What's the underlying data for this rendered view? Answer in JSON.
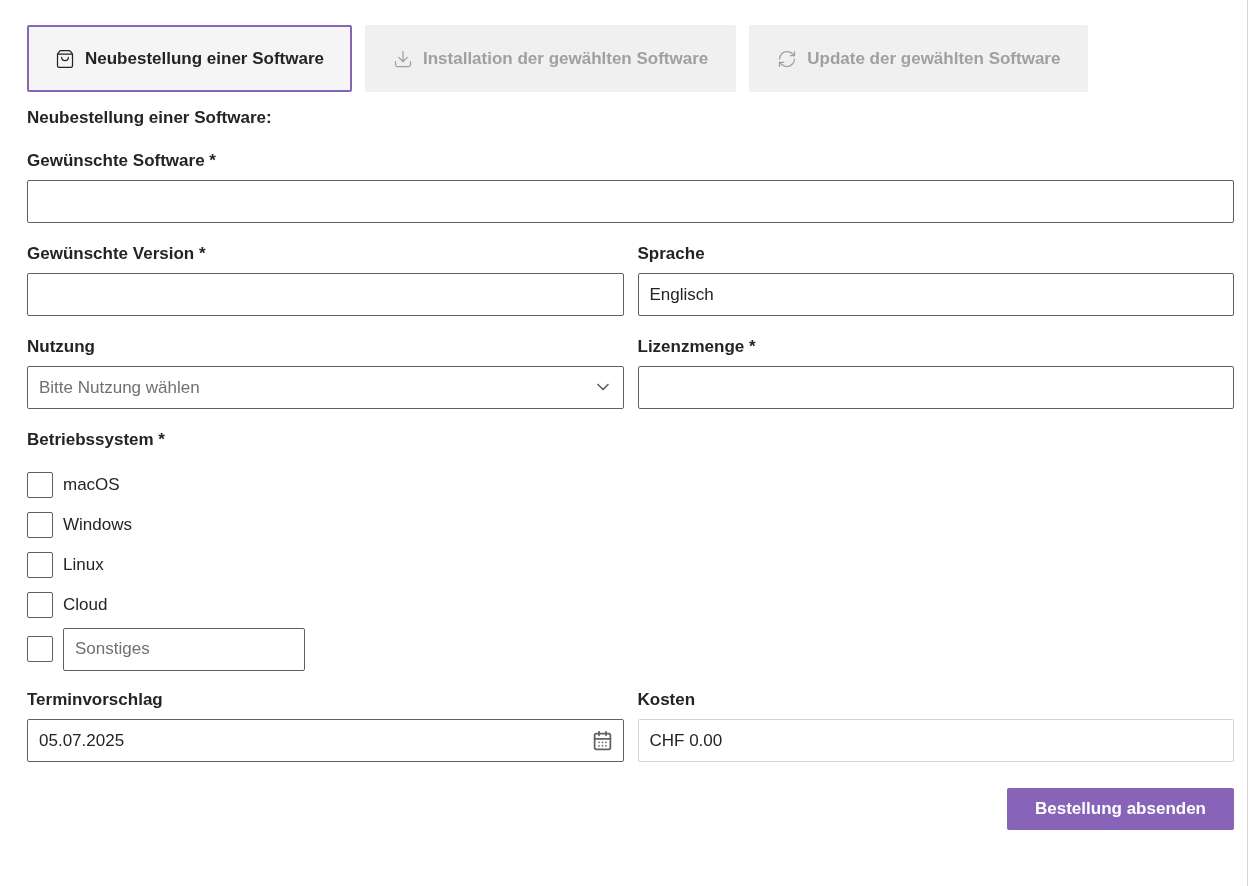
{
  "tabs": [
    {
      "label": "Neubestellung einer Software",
      "kind": "order",
      "selected": true
    },
    {
      "label": "Installation der gewählten Software",
      "kind": "install",
      "selected": false
    },
    {
      "label": "Update der gewählten Software",
      "kind": "update",
      "selected": false
    }
  ],
  "form": {
    "heading": "Neubestellung einer Software:",
    "rows": [
      {
        "fields": [
          {
            "label": "Gewünschte Software *",
            "kind": "text"
          }
        ]
      },
      {
        "fields": [
          {
            "label": "Gewünschte Version *",
            "kind": "text"
          },
          {
            "label": "Sprache",
            "kind": "text",
            "value": "Englisch"
          }
        ]
      },
      {
        "fields": [
          {
            "label": "Nutzung",
            "kind": "select",
            "placeholder": "Bitte Nutzung wählen"
          },
          {
            "label": "Lizenzmenge *",
            "kind": "text"
          }
        ]
      }
    ],
    "os": {
      "label": "Betriebssystem *",
      "options": [
        {
          "label": "macOS",
          "checked": false
        },
        {
          "label": "Windows",
          "checked": false
        },
        {
          "label": "Linux",
          "checked": false
        },
        {
          "label": "Cloud",
          "checked": false
        }
      ],
      "other": {
        "placeholder": "Sonstiges",
        "checked": false
      }
    },
    "bottom": {
      "fields": [
        {
          "label": "Terminvorschlag",
          "kind": "date",
          "value": "05.07.2025"
        },
        {
          "label": "Kosten",
          "kind": "readonly",
          "value": "CHF 0.00"
        }
      ]
    },
    "submit": "Bestellung absenden"
  }
}
